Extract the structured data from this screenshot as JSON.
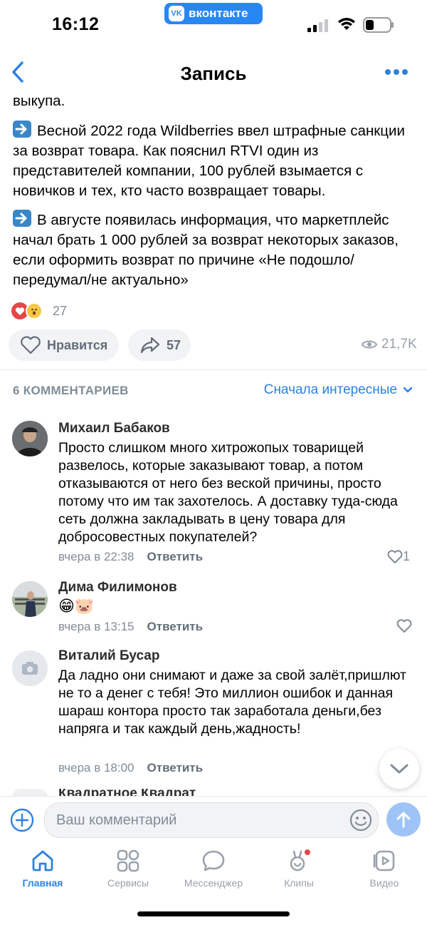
{
  "status_bar": {
    "time": "16:12",
    "app_pill_text": "вконтакте",
    "app_pill_logo": "vk"
  },
  "nav": {
    "title": "Запись"
  },
  "post": {
    "para0": "выкупа.",
    "para1": "Весной 2022 года Wildberries ввел штрафные санкции за возврат товара. Как пояснил RTVI один из представителей компании, 100 рублей взымается с новичков и тех, кто часто возвращает товары.",
    "para2": "В августе появилась информация, что маркетплейс начал брать 1 000 рублей за возврат некоторых заказов, если оформить возврат по причине «Не подошло/передумал/не актуально»",
    "reactions_count": "27",
    "like_label": "Нравится",
    "share_count": "57",
    "views": "21,7K"
  },
  "comments_section": {
    "header": "6 КОММЕНТАРИЕВ",
    "sort_label": "Сначала интересные",
    "items": [
      {
        "name": "Михаил Бабаков",
        "text": "Просто слишком много хитрожопых товарищей развелось, которые заказывают товар, а потом отказываются от него без веской причины, просто потому что им так захотелось. А доставку туда-сюда сеть должна закладывать в цену товара для добросовестных покупателей?",
        "time": "вчера в 22:38",
        "reply": "Ответить",
        "likes": "1"
      },
      {
        "name": "Дима Филимонов",
        "text": "😁🐷",
        "time": "вчера в 13:15",
        "reply": "Ответить",
        "likes": ""
      },
      {
        "name": "Виталий Бусар",
        "text": "Да ладно они снимают и даже за свой залёт,пришлют не то а денег с тебя! Это миллион ошибок и данная шараш контора просто так заработала деньги,без напряга и так каждый день,жадность!",
        "time": "вчера в 18:00",
        "reply": "Ответить",
        "likes": ""
      }
    ],
    "next_name_partial": "Квадратное Квадрат"
  },
  "composer": {
    "placeholder": "Ваш комментарий"
  },
  "tabbar": {
    "tabs": [
      {
        "label": "Главная",
        "icon": "home-icon",
        "active": true
      },
      {
        "label": "Сервисы",
        "icon": "services-icon",
        "active": false
      },
      {
        "label": "Мессенджер",
        "icon": "messenger-icon",
        "active": false
      },
      {
        "label": "Клипы",
        "icon": "clips-icon",
        "active": false
      },
      {
        "label": "Видео",
        "icon": "video-icon",
        "active": false
      }
    ]
  },
  "colors": {
    "accent": "#2d81e0",
    "secondary_text": "#818c99",
    "pill_bg": "#f2f3f5"
  }
}
